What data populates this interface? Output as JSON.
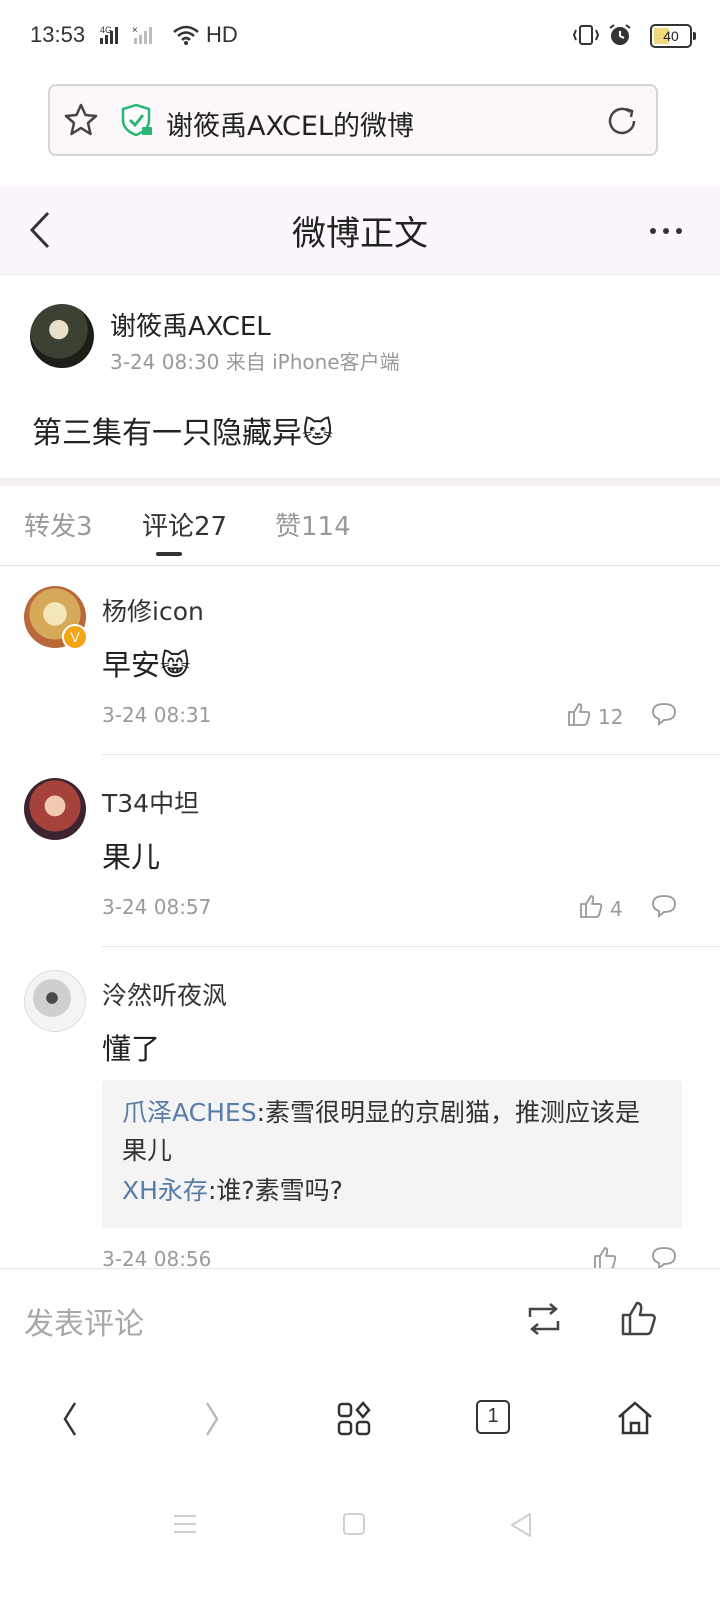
{
  "status_bar": {
    "time": "13:53",
    "network": "4G",
    "network_type": "HD",
    "battery": "40"
  },
  "address_bar": {
    "title": "谢筱禹AXCEL的微博"
  },
  "header": {
    "title": "微博正文"
  },
  "post": {
    "author": "谢筱禹AXCEL",
    "meta": "3-24 08:30 来自 iPhone客户端",
    "text": "第三集有一只隐藏异🐱"
  },
  "tabs": [
    {
      "label": "转发3",
      "active": false
    },
    {
      "label": "评论27",
      "active": true
    },
    {
      "label": "赞114",
      "active": false
    }
  ],
  "comments": [
    {
      "name": "杨修icon",
      "text": "早安😸",
      "time": "3-24 08:31",
      "likes": "12",
      "verified": true
    },
    {
      "name": "T34中坦",
      "text": "果儿",
      "time": "3-24 08:57",
      "likes": "4",
      "verified": false
    },
    {
      "name": "泠然听夜沨",
      "text": "懂了",
      "time": "3-24 08:56",
      "likes": "",
      "verified": false,
      "replies": [
        {
          "name": "爪泽ACHES",
          "text": ":素雪很明显的京剧猫，推测应该是果儿"
        },
        {
          "name": "XH永存",
          "text": ":谁?素雪吗?"
        }
      ]
    }
  ],
  "comment_bar": {
    "placeholder": "发表评论"
  },
  "browser_nav": {
    "tab_count": "1"
  },
  "colors": {
    "accent_link": "#587ca8",
    "verified_badge": "#f3a513",
    "muted_text": "#9a9a9a"
  }
}
